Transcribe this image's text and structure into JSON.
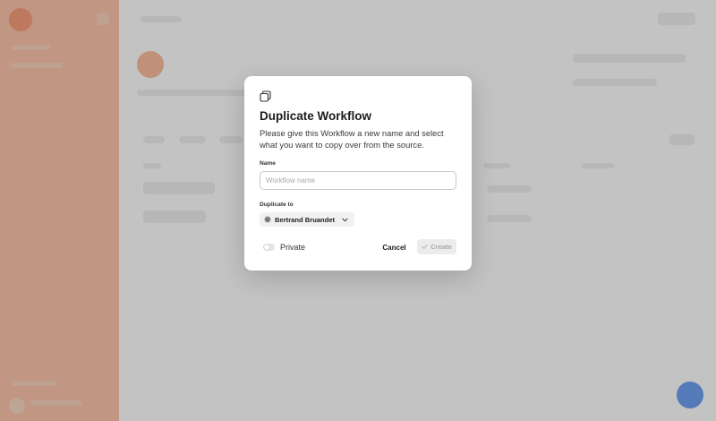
{
  "modal": {
    "title": "Duplicate Workflow",
    "description": "Please give this Workflow a new name and select what you want to copy over from the source.",
    "name_label": "Name",
    "name_value": "",
    "name_placeholder": "Workflow name",
    "duplicate_to_label": "Duplicate to",
    "duplicate_to_value": "Bertrand Bruandet",
    "private_label": "Private",
    "private_enabled": false,
    "cancel_label": "Cancel",
    "create_label": "Create",
    "create_enabled": false
  },
  "icons": {
    "header": "duplicate-icon",
    "select_avatar": "user-avatar-icon",
    "select_chevron": "chevron-down-icon",
    "create": "check-icon"
  },
  "colors": {
    "sidebar": "#f6ac8a",
    "brand": "#ef7a4a",
    "fab": "#3b7de8",
    "overlay": "rgba(120,120,120,0.42)"
  }
}
